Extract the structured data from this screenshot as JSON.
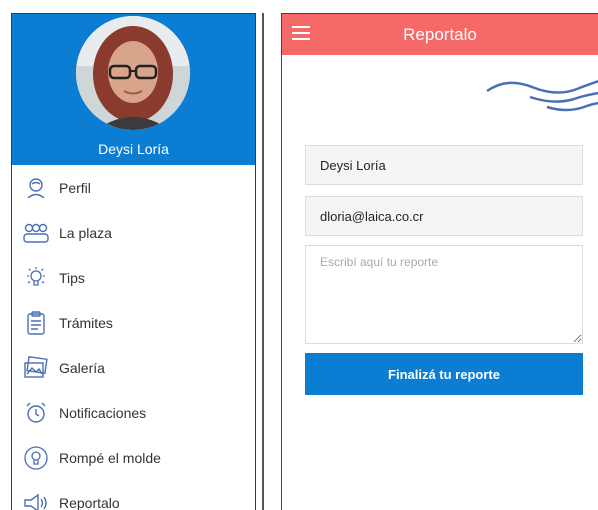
{
  "drawer": {
    "user_name": "Deysi Loría",
    "items": [
      {
        "label": "Perfil",
        "icon": "person-icon"
      },
      {
        "label": "La plaza",
        "icon": "group-icon"
      },
      {
        "label": "Tips",
        "icon": "lightbulb-icon"
      },
      {
        "label": "Trámites",
        "icon": "clipboard-icon"
      },
      {
        "label": "Galería",
        "icon": "photos-icon"
      },
      {
        "label": "Notificaciones",
        "icon": "alarm-clock-icon"
      },
      {
        "label": "Rompé el molde",
        "icon": "bulb-badge-icon"
      },
      {
        "label": "Reportalo",
        "icon": "megaphone-icon"
      }
    ]
  },
  "report": {
    "title": "Reportalo",
    "name_value": "Deysi Loría",
    "email_value": "dloria@laica.co.cr",
    "report_placeholder": "Escribí aquí tu reporte",
    "submit_label": "Finalizá tu reporte"
  },
  "colors": {
    "drawer_header": "#0b7ed3",
    "app_bar": "#f56a68",
    "button": "#0b7ed3",
    "waves": "#4a6fb5"
  }
}
